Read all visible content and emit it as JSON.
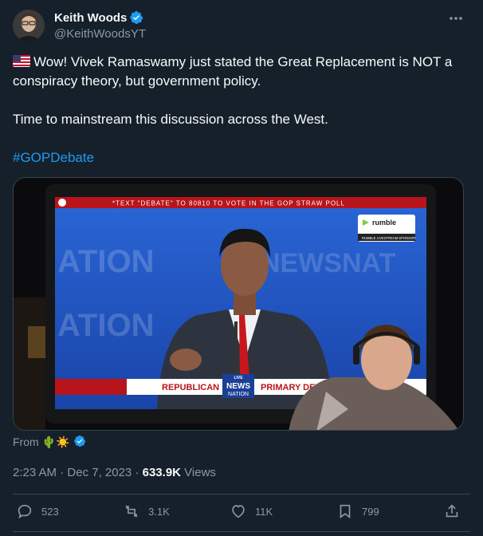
{
  "author": {
    "display_name": "Keith Woods",
    "handle": "@KeithWoodsYT",
    "verified": true
  },
  "post": {
    "line1": "Wow! Vivek Ramaswamy just stated the Great Replacement is NOT a conspiracy theory, but government policy.",
    "line2": "Time to mainstream this discussion across the West.",
    "hashtag": "#GOPDebate",
    "flag_icon": "us-flag-icon"
  },
  "media": {
    "ticker": "*TEXT \"DEBATE\" TO 80810 TO VOTE IN THE GOP STRAW POLL",
    "rumble_label": "rumble",
    "rumble_sub": "RUMBLE LIVESTREAM SPONSOR",
    "lower_left": "REPUBLICAN",
    "lower_right": "PRIMARY DEBATE",
    "logo_top": "LIVE",
    "logo_mid": "NEWS",
    "logo_bot": "NATION",
    "bg_word_a": "ATION",
    "bg_word_b": "NEWSNAT"
  },
  "from": {
    "label": "From",
    "emojis": "🌵☀️"
  },
  "meta": {
    "time": "2:23 AM",
    "date": "Dec 7, 2023",
    "views_count": "633.9K",
    "views_label": "Views"
  },
  "actions": {
    "replies": "523",
    "reposts": "3.1K",
    "likes": "11K",
    "bookmarks": "799"
  },
  "colors": {
    "background": "#15202b",
    "accent": "#1d9bf0",
    "muted": "#8b98a5",
    "divider": "#38444d"
  }
}
